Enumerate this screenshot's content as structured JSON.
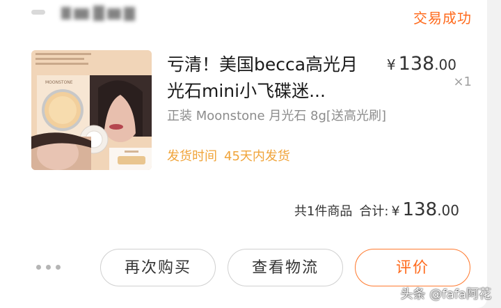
{
  "order": {
    "status": "交易成功",
    "product": {
      "image_alt": "becca 高光 Moonstone 产品图",
      "image_label": "MOONSTONE",
      "title_line1": "亏清！美国becca高光月",
      "title_line2": "光石mini小飞碟迷...",
      "sku": "正装 Moonstone 月光石 8g[送高光刷]",
      "shipping_label": "发货时间",
      "shipping_value": "45天内发货",
      "price_symbol": "¥",
      "price_int": "138",
      "price_dec": ".00",
      "quantity": "×1"
    },
    "summary": {
      "count_text": "共1件商品",
      "total_label": "合计:",
      "symbol": "¥",
      "total_int": "138",
      "total_dec": ".00"
    },
    "actions": {
      "rebuy": "再次购买",
      "logistics": "查看物流",
      "review": "评价"
    }
  },
  "watermark": "头条 @fafa阿花",
  "colors": {
    "accent": "#ff6a1c",
    "shipping": "#f0a43a"
  }
}
